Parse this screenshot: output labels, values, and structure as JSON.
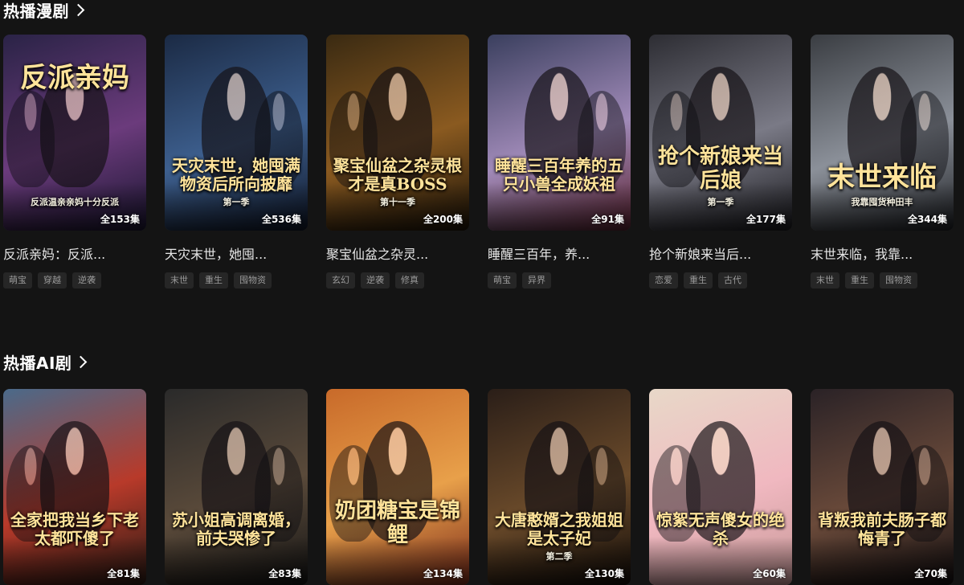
{
  "sections": [
    {
      "title": "热播漫剧",
      "cards": [
        {
          "name": "反派亲妈：反派...",
          "poster_text": "反派亲妈",
          "poster_sub": "反派温亲亲妈十分反派",
          "episodes": "全153集",
          "tags": [
            "萌宝",
            "穿越",
            "逆袭"
          ],
          "bg": [
            "#2a2346",
            "#6b3b7c",
            "#1a1530"
          ]
        },
        {
          "name": "天灾末世，她囤...",
          "poster_text": "天灾末世，她囤满物资后所向披靡",
          "poster_sub": "第一季",
          "episodes": "全536集",
          "tags": [
            "末世",
            "重生",
            "囤物资"
          ],
          "bg": [
            "#1b2a44",
            "#3d5f8e",
            "#0f1626"
          ]
        },
        {
          "name": "聚宝仙盆之杂灵...",
          "poster_text": "聚宝仙盆之杂灵根才是真BOSS",
          "poster_sub": "第十一季",
          "episodes": "全200集",
          "tags": [
            "玄幻",
            "逆袭",
            "修真"
          ],
          "bg": [
            "#3a2a12",
            "#8a5a20",
            "#1d1408"
          ]
        },
        {
          "name": "睡醒三百年，养...",
          "poster_text": "睡醒三百年养的五只小兽全成妖祖",
          "poster_sub": "",
          "episodes": "全91集",
          "tags": [
            "萌宝",
            "异界"
          ],
          "bg": [
            "#3a3f5e",
            "#a08ab8",
            "#5a2230"
          ]
        },
        {
          "name": "抢个新娘来当后...",
          "poster_text": "抢个新娘来当后娘",
          "poster_sub": "第一季",
          "episodes": "全177集",
          "tags": [
            "恋爱",
            "重生",
            "古代"
          ],
          "bg": [
            "#2d2d33",
            "#7a7a86",
            "#1a1a1e"
          ]
        },
        {
          "name": "末世来临，我靠...",
          "poster_text": "末世来临",
          "poster_sub": "我靠囤货种田丰",
          "episodes": "全344集",
          "tags": [
            "末世",
            "重生",
            "囤物资"
          ],
          "bg": [
            "#3a3d42",
            "#8b9099",
            "#1e2024"
          ]
        }
      ]
    },
    {
      "title": "热播AI剧",
      "cards": [
        {
          "name": "",
          "poster_text": "全家把我当乡下老太都吓傻了",
          "poster_sub": "",
          "episodes": "全81集",
          "tags": [],
          "bg": [
            "#4a6a8a",
            "#b83a2a",
            "#2a1a14"
          ]
        },
        {
          "name": "",
          "poster_text": "苏小姐高调离婚，前夫哭惨了",
          "poster_sub": "",
          "episodes": "全83集",
          "tags": [],
          "bg": [
            "#2a2a2a",
            "#5a4a3a",
            "#141414"
          ]
        },
        {
          "name": "",
          "poster_text": "奶团糖宝是锦鲤",
          "poster_sub": "",
          "episodes": "全134集",
          "tags": [],
          "bg": [
            "#c86a2a",
            "#e8a04a",
            "#7a2a1a"
          ]
        },
        {
          "name": "",
          "poster_text": "大唐憨婿之我姐姐是太子妃",
          "poster_sub": "第二季",
          "episodes": "全130集",
          "tags": [],
          "bg": [
            "#2a1e18",
            "#6a4a2a",
            "#120c08"
          ]
        },
        {
          "name": "",
          "poster_text": "惊絮无声傻女的绝杀",
          "poster_sub": "",
          "episodes": "全60集",
          "tags": [],
          "bg": [
            "#e8d8c8",
            "#f0b8c0",
            "#c89898"
          ]
        },
        {
          "name": "",
          "poster_text": "背叛我前夫肠子都悔青了",
          "poster_sub": "",
          "episodes": "全70集",
          "tags": [],
          "bg": [
            "#2a2226",
            "#6a4a3a",
            "#120e10"
          ]
        }
      ]
    }
  ]
}
